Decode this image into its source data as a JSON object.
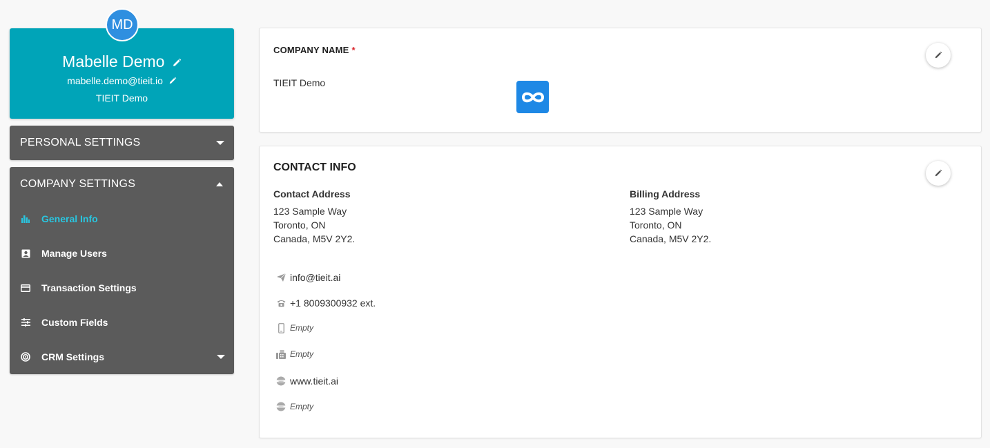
{
  "profile": {
    "initials": "MD",
    "name": "Mabelle Demo",
    "email": "mabelle.demo@tieit.io",
    "company": "TIEIT Demo"
  },
  "menus": {
    "personal": {
      "label": "PERSONAL SETTINGS"
    },
    "company": {
      "label": "COMPANY SETTINGS",
      "items": [
        {
          "label": "General Info",
          "icon": "building-chart-icon",
          "active": true
        },
        {
          "label": "Manage Users",
          "icon": "user-card-icon"
        },
        {
          "label": "Transaction Settings",
          "icon": "credit-card-icon"
        },
        {
          "label": "Custom Fields",
          "icon": "sliders-icon"
        },
        {
          "label": "CRM Settings",
          "icon": "target-icon"
        }
      ]
    }
  },
  "company_card": {
    "label": "COMPANY NAME",
    "required_mark": "*",
    "value": "TIEIT Demo"
  },
  "contact_card": {
    "title": "CONTACT INFO",
    "contact_address": {
      "heading": "Contact Address",
      "lines": [
        "123 Sample Way",
        "Toronto, ON",
        "Canada, M5V 2Y2."
      ]
    },
    "billing_address": {
      "heading": "Billing Address",
      "lines": [
        "123 Sample Way",
        "Toronto, ON",
        "Canada, M5V 2Y2."
      ]
    },
    "email": "info@tieit.ai",
    "phone": "+1 8009300932 ext.",
    "mobile": "Empty",
    "fax": "Empty",
    "website": "www.tieit.ai",
    "website2": "Empty"
  },
  "colors": {
    "profile_bg": "#00a4b8",
    "menu_bg": "#5b5b5b",
    "active_item": "#29c6e0",
    "logo_bg": "#1e88e5",
    "required": "#d9262c"
  }
}
